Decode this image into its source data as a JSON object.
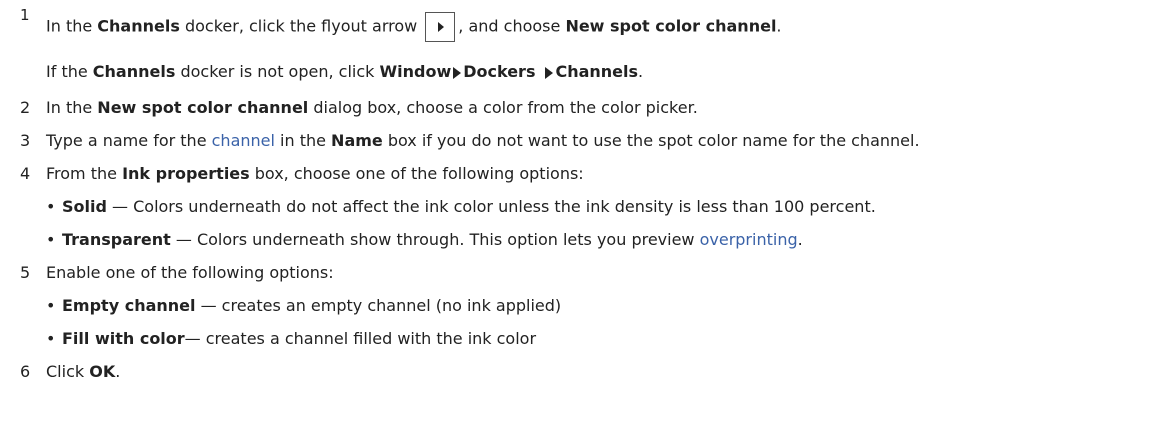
{
  "steps": [
    {
      "num": "1",
      "a": "In the ",
      "channels": "Channels",
      "b": " docker, click the flyout arrow ",
      "c": ", and choose ",
      "new_spot": "New spot color channel",
      "d": ".",
      "sub_a": "If the ",
      "sub_channels": "Channels",
      "sub_b": " docker is not open, click ",
      "menu_window": "Window",
      "menu_dockers": "Dockers",
      "menu_channels": "Channels",
      "sub_end": "."
    },
    {
      "num": "2",
      "a": "In the ",
      "dialog": "New spot color channel",
      "b": " dialog box, choose a color from the color picker."
    },
    {
      "num": "3",
      "a": "Type a name for the ",
      "channel_link": "channel",
      "b": " in the ",
      "name": "Name",
      "c": " box if you do not want to use the spot color name for the channel."
    },
    {
      "num": "4",
      "a": "From the ",
      "ink": "Ink properties",
      "b": " box, choose one of the following options:",
      "opt1_label": "Solid",
      "opt1_text": " — Colors underneath do not affect the ink color unless the ink density is less than 100 percent.",
      "opt2_label": "Transparent",
      "opt2_text": " — Colors underneath show through. This option lets you preview ",
      "opt2_link": "overprinting",
      "opt2_end": "."
    },
    {
      "num": "5",
      "a": "Enable one of the following options:",
      "opt1_label": "Empty channel",
      "opt1_text": " — creates an empty channel (no ink applied)",
      "opt2_label": "Fill with color",
      "opt2_text": "— creates a channel filled with the ink color"
    },
    {
      "num": "6",
      "a": "Click ",
      "ok": "OK",
      "b": "."
    }
  ],
  "bullet": "•",
  "icons": {
    "flyout": "flyout-arrow-icon",
    "menu_arrow": "menu-arrow-right-icon"
  }
}
